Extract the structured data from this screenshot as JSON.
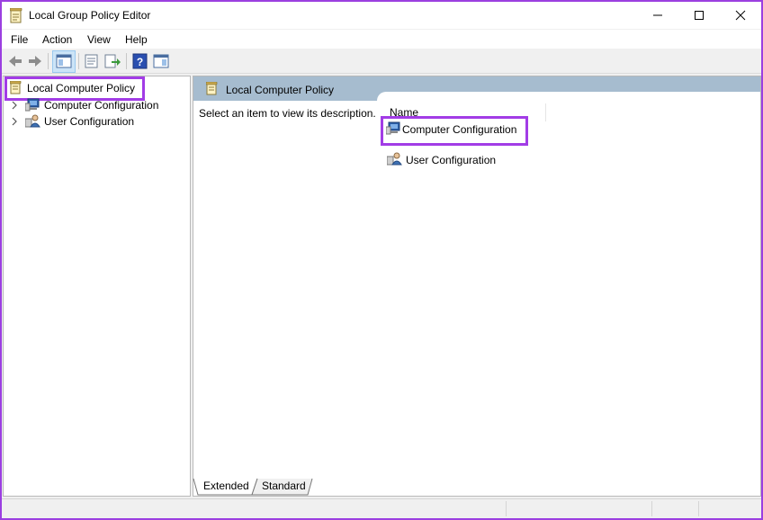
{
  "window": {
    "title": "Local Group Policy Editor",
    "controls": [
      "minimize",
      "maximize",
      "close"
    ]
  },
  "menu": {
    "file": "File",
    "action": "Action",
    "view": "View",
    "help": "Help"
  },
  "toolbar": {
    "buttons": [
      "back-arrow-icon",
      "forward-arrow-icon",
      "show-hide-console-tree-icon",
      "properties-icon",
      "export-list-icon",
      "help-icon",
      "show-hide-action-pane-icon"
    ]
  },
  "tree": {
    "root": "Local Computer Policy",
    "items": [
      {
        "label": "Computer Configuration",
        "icon": "computer-configuration-icon"
      },
      {
        "label": "User Configuration",
        "icon": "user-configuration-icon"
      }
    ]
  },
  "content": {
    "header_title": "Local Computer Policy",
    "description": "Select an item to view its description.",
    "column_name": "Name",
    "items": [
      {
        "label": "Computer Configuration",
        "icon": "computer-configuration-icon"
      },
      {
        "label": "User Configuration",
        "icon": "user-configuration-icon"
      }
    ]
  },
  "tabs": {
    "extended": "Extended",
    "standard": "Standard"
  },
  "colors": {
    "highlight": "#a23ce6",
    "header_band": "#a6bccf",
    "background": "#9b3fe0"
  }
}
